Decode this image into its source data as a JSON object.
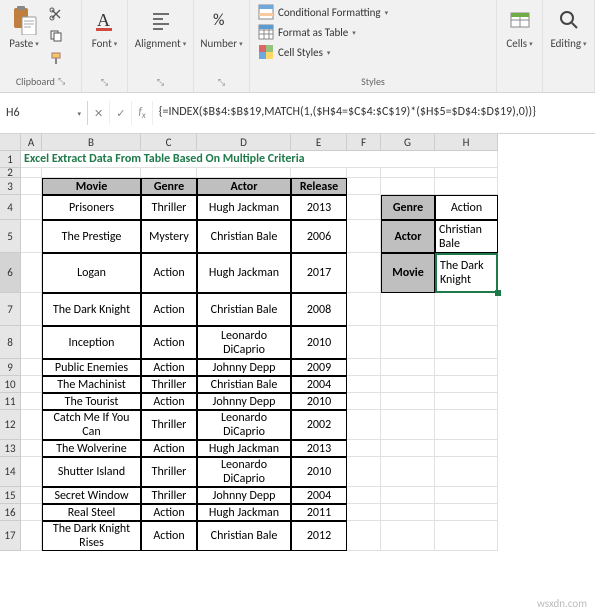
{
  "ribbon": {
    "clipboard": {
      "paste": "Paste",
      "label": "Clipboard"
    },
    "font": {
      "label": "Font"
    },
    "alignment": {
      "label": "Alignment"
    },
    "number": {
      "label": "Number"
    },
    "styles": {
      "cond": "Conditional Formatting",
      "fat": "Format as Table",
      "cstyle": "Cell Styles",
      "label": "Styles"
    },
    "cells": {
      "label": "Cells"
    },
    "editing": {
      "label": "Editing"
    }
  },
  "namebox": "H6",
  "formula": "{=INDEX($B$4:$B$19,MATCH(1,($H$4=$C$4:$C$19)*($H$5=$D$4:$D$19),0))}",
  "cols": [
    "A",
    "B",
    "C",
    "D",
    "E",
    "F",
    "G",
    "H"
  ],
  "rowNums": [
    "1",
    "2",
    "3",
    "4",
    "5",
    "6",
    "7",
    "8",
    "9",
    "10",
    "11",
    "12",
    "13",
    "14",
    "15",
    "16",
    "17"
  ],
  "title": "Excel Extract Data From Table Based On Multiple Criteria",
  "headers": {
    "movie": "Movie",
    "genre": "Genre",
    "actor": "Actor",
    "release": "Release"
  },
  "rows": [
    {
      "movie": "Prisoners",
      "genre": "Thriller",
      "actor": "Hugh Jackman",
      "release": "2013"
    },
    {
      "movie": "The Prestige",
      "genre": "Mystery",
      "actor": "Christian Bale",
      "release": "2006"
    },
    {
      "movie": "Logan",
      "genre": "Action",
      "actor": "Hugh Jackman",
      "release": "2017"
    },
    {
      "movie": "The Dark Knight",
      "genre": "Action",
      "actor": "Christian Bale",
      "release": "2008"
    },
    {
      "movie": "Inception",
      "genre": "Action",
      "actor": "Leonardo DiCaprio",
      "release": "2010"
    },
    {
      "movie": "Public Enemies",
      "genre": "Action",
      "actor": "Johnny Depp",
      "release": "2009"
    },
    {
      "movie": "The Machinist",
      "genre": "Thriller",
      "actor": "Christian Bale",
      "release": "2004"
    },
    {
      "movie": "The Tourist",
      "genre": "Action",
      "actor": "Johnny Depp",
      "release": "2010"
    },
    {
      "movie": "Catch Me If You Can",
      "genre": "Thriller",
      "actor": "Leonardo DiCaprio",
      "release": "2002"
    },
    {
      "movie": "The Wolverine",
      "genre": "Action",
      "actor": "Hugh Jackman",
      "release": "2013"
    },
    {
      "movie": "Shutter Island",
      "genre": "Thriller",
      "actor": "Leonardo DiCaprio",
      "release": "2010"
    },
    {
      "movie": "Secret Window",
      "genre": "Thriller",
      "actor": "Johnny Depp",
      "release": "2004"
    },
    {
      "movie": "Real Steel",
      "genre": "Action",
      "actor": "Hugh Jackman",
      "release": "2011"
    },
    {
      "movie": "The Dark Knight Rises",
      "genre": "Action",
      "actor": "Christian Bale",
      "release": "2012"
    }
  ],
  "lookup": {
    "genreLabel": "Genre",
    "genreVal": "Action",
    "actorLabel": "Actor",
    "actorVal": "Christian Bale",
    "movieLabel": "Movie",
    "movieVal": "The Dark Knight"
  },
  "watermark": "wsxdn.com"
}
